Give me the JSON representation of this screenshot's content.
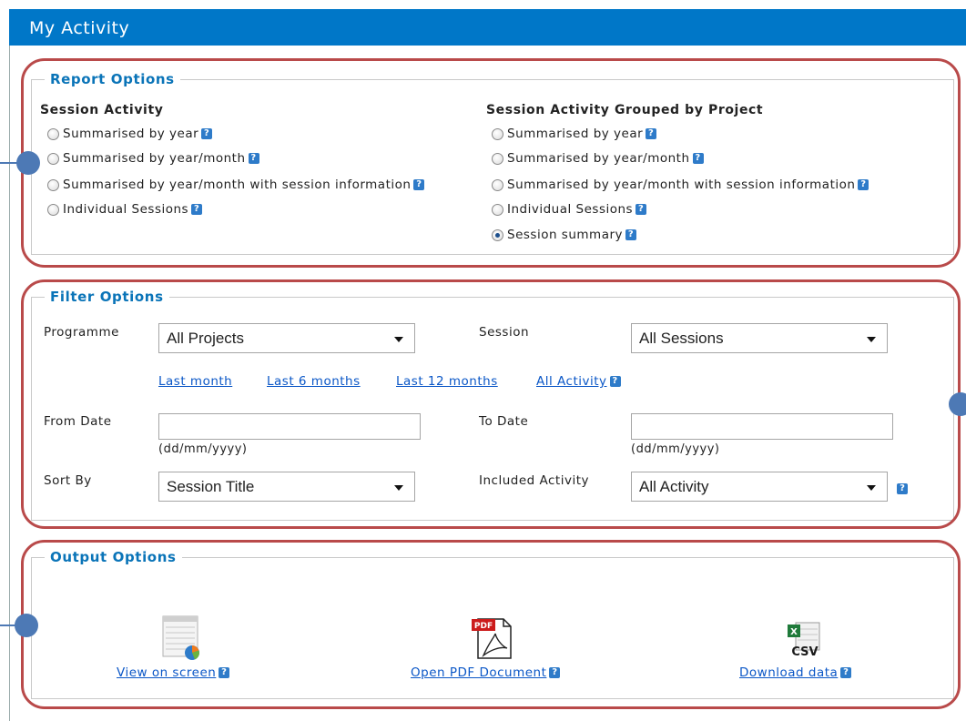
{
  "title": "My Activity",
  "report_options": {
    "legend": "Report Options",
    "session_activity": {
      "heading": "Session Activity",
      "options": [
        {
          "label": "Summarised by year",
          "checked": false
        },
        {
          "label": "Summarised by year/month",
          "checked": false
        },
        {
          "label": "Summarised by year/month with session information",
          "checked": false
        },
        {
          "label": "Individual Sessions",
          "checked": false
        }
      ]
    },
    "grouped_by_project": {
      "heading": "Session Activity Grouped by Project",
      "options": [
        {
          "label": "Summarised by year",
          "checked": false
        },
        {
          "label": "Summarised by year/month",
          "checked": false
        },
        {
          "label": "Summarised by year/month with session information",
          "checked": false
        },
        {
          "label": "Individual Sessions",
          "checked": false
        },
        {
          "label": "Session summary",
          "checked": true
        }
      ]
    }
  },
  "filter_options": {
    "legend": "Filter Options",
    "programme_label": "Programme",
    "programme_value": "All Projects",
    "session_label": "Session",
    "session_value": "All Sessions",
    "quick_links": [
      "Last month",
      "Last 6 months",
      "Last 12 months",
      "All Activity"
    ],
    "from_label": "From Date",
    "from_value": "",
    "to_label": "To Date",
    "to_value": "",
    "date_hint": "(dd/mm/yyyy)",
    "sort_label": "Sort By",
    "sort_value": "Session Title",
    "included_label": "Included Activity",
    "included_value": "All Activity"
  },
  "output_options": {
    "legend": "Output Options",
    "view_label": "View on screen",
    "pdf_label": "Open PDF Document",
    "pdf_badge": "PDF",
    "download_label": "Download data",
    "csv_badge": "CSV"
  },
  "help_glyph": "?",
  "colors": {
    "title_bar": "#0077c8",
    "legend": "#0a74b8",
    "highlight": "#b94a4a",
    "marker": "#4d79b5",
    "link": "#0b57c7"
  }
}
